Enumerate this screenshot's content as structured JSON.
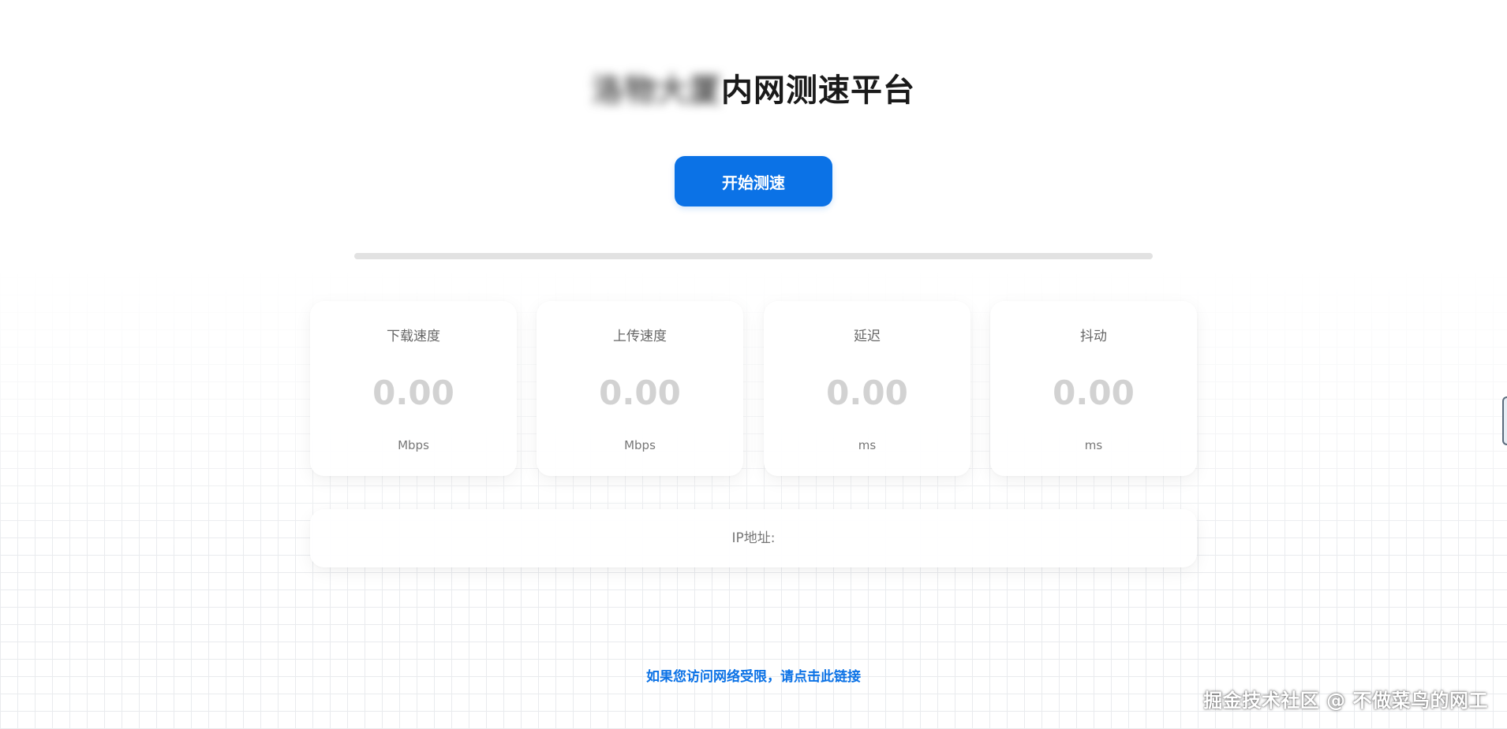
{
  "header": {
    "title_blurred": "洛物大厦",
    "title": "内网测速平台"
  },
  "controls": {
    "start_label": "开始测速",
    "progress_fraction": 0
  },
  "metrics": [
    {
      "label": "下载速度",
      "value": "0.00",
      "unit": "Mbps"
    },
    {
      "label": "上传速度",
      "value": "0.00",
      "unit": "Mbps"
    },
    {
      "label": "延迟",
      "value": "0.00",
      "unit": "ms"
    },
    {
      "label": "抖动",
      "value": "0.00",
      "unit": "ms"
    }
  ],
  "ip": {
    "label": "IP地址:"
  },
  "footer": {
    "restricted_link": "如果您访问网络受限，请点击此链接"
  },
  "watermark": "掘金技术社区 @ 不做菜鸟的网工",
  "colors": {
    "accent": "#0b72e6",
    "muted_value": "#d2d2d2"
  }
}
